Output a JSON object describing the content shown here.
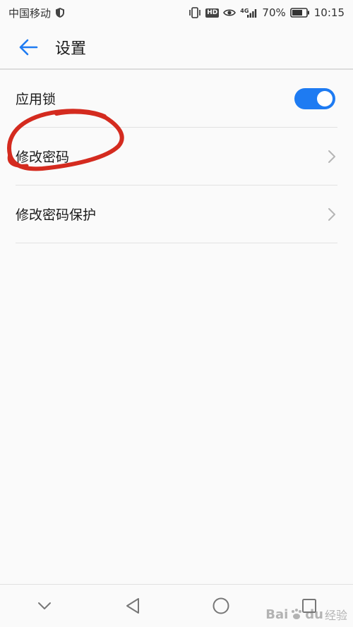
{
  "status_bar": {
    "carrier": "中国移动",
    "network_type": "4G",
    "battery": "70%",
    "time": "10:15",
    "icons": [
      "shield-icon",
      "vibrate-icon",
      "hd-icon",
      "eye-icon",
      "signal-icon",
      "battery-icon"
    ]
  },
  "app_bar": {
    "back_icon": "arrow-left-icon",
    "title": "设置"
  },
  "settings": {
    "items": [
      {
        "label": "应用锁",
        "control": "toggle",
        "toggle_on": true
      },
      {
        "label": "修改密码",
        "control": "chevron"
      },
      {
        "label": "修改密码保护",
        "control": "chevron"
      }
    ]
  },
  "annotation": {
    "color": "#d42b1f",
    "target": "修改密码"
  },
  "nav_bar": {
    "icons": [
      "chevron-down-icon",
      "back-triangle-icon",
      "home-circle-icon",
      "recents-square-icon"
    ]
  },
  "watermark": {
    "text_bai": "Bai",
    "text_du": "du",
    "text_jingyan": "经验"
  },
  "colors": {
    "accent": "#1e7bf2",
    "background": "#fafafa",
    "annotation": "#d42b1f"
  }
}
